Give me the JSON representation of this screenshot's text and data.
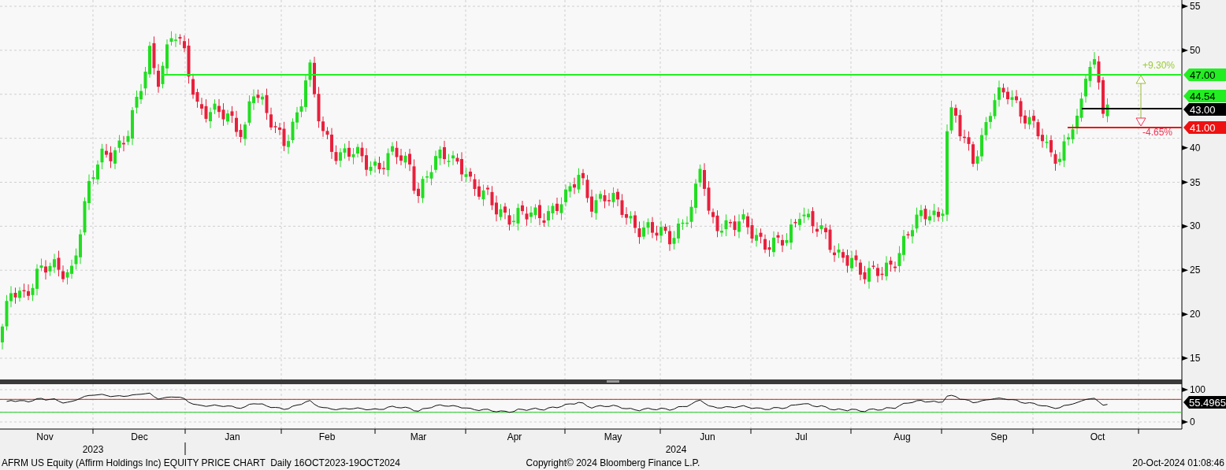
{
  "price_panel": {
    "y_axis_labels": [
      "55",
      "50",
      "40",
      "35",
      "30",
      "25",
      "20",
      "15"
    ],
    "price_tags": [
      {
        "label": "47.00",
        "color": "#22ee22"
      },
      {
        "label": "44.54",
        "color": "#22ee22"
      },
      {
        "label": "43.00",
        "color": "#000000"
      },
      {
        "label": "41.00",
        "color": "#ee1111"
      }
    ],
    "change_labels": [
      {
        "label": "+9.30%",
        "color": "#99cc33"
      },
      {
        "label": "-4.65%",
        "color": "#ee3355"
      }
    ]
  },
  "rsi_panel": {
    "y_axis_labels": [
      "100",
      "0"
    ],
    "value_tag": "55.4965"
  },
  "x_axis": {
    "months": [
      "Nov",
      "Dec",
      "Jan",
      "Feb",
      "Mar",
      "Apr",
      "May",
      "Jun",
      "Jul",
      "Aug",
      "Sep",
      "Oct"
    ],
    "years": [
      "2023",
      "2024"
    ]
  },
  "footer": {
    "title": "AFRM US Equity (Affirm Holdings Inc) EQUITY PRICE CHART  Daily 16OCT2023-19OCT2024",
    "copyright": "Copyright© 2024 Bloomberg Finance L.P.",
    "timestamp": "20-Oct-2024 01:08:46"
  }
}
